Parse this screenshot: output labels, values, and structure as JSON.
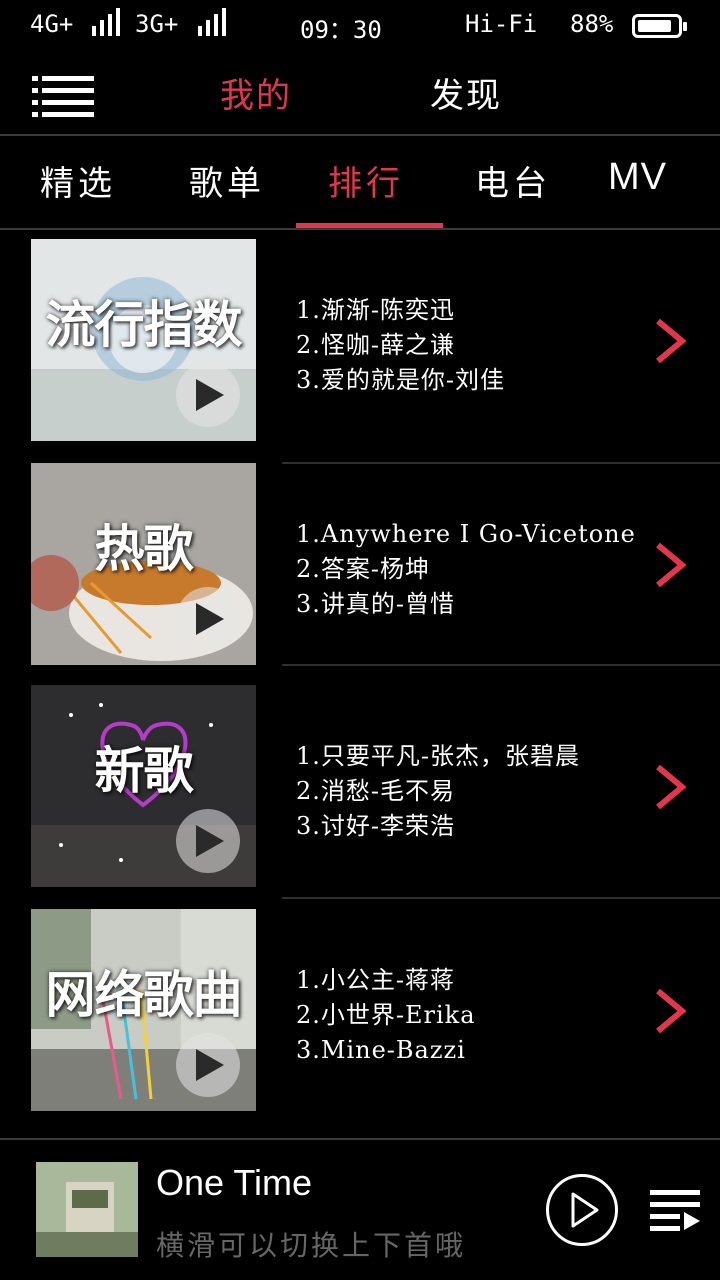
{
  "status_bar": {
    "net1": "4G+",
    "net2": "3G+",
    "time": "09：30",
    "audio": "Hi-Fi",
    "battery": "88%",
    "battery_level": 0.88
  },
  "header": {
    "tab_mine": "我的",
    "tab_discover": "发现",
    "active_color": "#e2364d"
  },
  "subtabs": [
    "精选",
    "歌单",
    "排行",
    "电台",
    "MV"
  ],
  "charts": [
    {
      "name": "流行指数",
      "songs": [
        "1.渐渐-陈奕迅",
        "2.怪咖-薛之谦",
        "3.爱的就是你-刘佳"
      ]
    },
    {
      "name": "热歌",
      "songs": [
        "1.Anywhere I Go-Vicetone",
        "2.答案-杨坤",
        "3.讲真的-曾惜"
      ]
    },
    {
      "name": "新歌",
      "songs": [
        "1.只要平凡-张杰，张碧晨",
        "2.消愁-毛不易",
        "3.讨好-李荣浩"
      ]
    },
    {
      "name": "网络歌曲",
      "songs": [
        "1.小公主-蒋蒋",
        "2.小世界-Erika",
        "3.Mine-Bazzi"
      ]
    }
  ],
  "player": {
    "title": "One Time",
    "hint": "横滑可以切换上下首哦"
  },
  "icons": {
    "menu": "menu-icon",
    "play": "play-icon",
    "chevron": "chevron-right-icon",
    "queue": "playlist-queue-icon"
  }
}
